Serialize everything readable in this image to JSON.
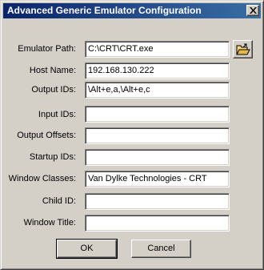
{
  "window": {
    "title": "Advanced Generic Emulator Configuration"
  },
  "form": {
    "fields": [
      {
        "label": "Emulator Path:",
        "value": "C:\\CRT\\CRT.exe"
      },
      {
        "label": "Host Name:",
        "value": "192.168.130.222"
      },
      {
        "label": "Output IDs:",
        "value": "\\Alt+e,a,\\Alt+e,c"
      },
      {
        "label": "Input IDs:",
        "value": ""
      },
      {
        "label": "Output Offsets:",
        "value": ""
      },
      {
        "label": "Startup IDs:",
        "value": ""
      },
      {
        "label": "Window Classes:",
        "value": "Van Dylke Technologies - CRT"
      },
      {
        "label": "Child ID:",
        "value": ""
      },
      {
        "label": "Window Title:",
        "value": ""
      }
    ]
  },
  "buttons": {
    "ok_label": "OK",
    "cancel_label": "Cancel"
  },
  "icons": {
    "browse": "folder-open-icon",
    "close": "close-icon"
  }
}
